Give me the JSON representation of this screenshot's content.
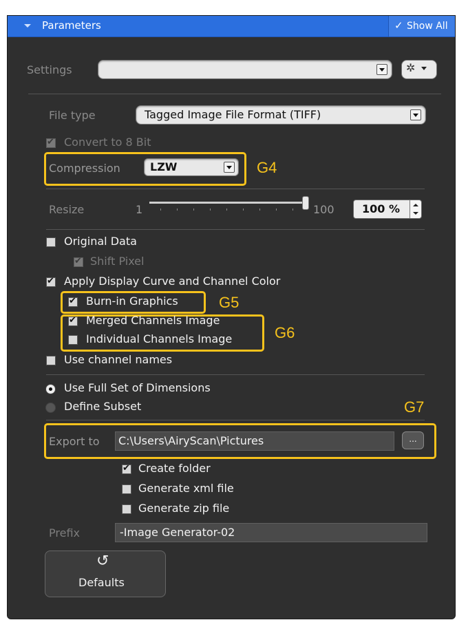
{
  "header": {
    "title": "Parameters",
    "show_all": "Show All",
    "check_glyph": "✓"
  },
  "settings": {
    "label": "Settings",
    "value": "",
    "gear_glyph": "✲"
  },
  "file_type": {
    "label": "File type",
    "value": "Tagged Image File Format (TIFF)"
  },
  "convert": {
    "label": "Convert to 8 Bit",
    "checked": true
  },
  "compression": {
    "label": "Compression",
    "value": "LZW"
  },
  "resize": {
    "label": "Resize",
    "min": "1",
    "max": "100",
    "value": "100 %",
    "level": 1.0
  },
  "options": {
    "original_data": "Original Data",
    "shift_pixel": "Shift Pixel",
    "apply_display": "Apply Display Curve and Channel Color",
    "burn_in": "Burn-in Graphics",
    "merged": "Merged Channels Image",
    "individual": "Individual Channels Image",
    "channel_names": "Use channel names"
  },
  "dimensions": {
    "full_set": "Use Full Set of Dimensions",
    "subset": "Define Subset"
  },
  "export": {
    "label": "Export to",
    "path": "C:\\Users\\AiryScan\\Pictures",
    "browse": "..."
  },
  "export_options": {
    "create_folder": "Create folder",
    "xml": "Generate xml file",
    "zip": "Generate zip file"
  },
  "prefix": {
    "label": "Prefix",
    "value": "-Image Generator-02"
  },
  "defaults": {
    "label": "Defaults",
    "icon_glyph": "↺"
  },
  "annotations": {
    "g4": "G4",
    "g5": "G5",
    "g6": "G6",
    "g7": "G7"
  },
  "colors": {
    "accent": "#2b6fdf",
    "panel": "#2f2f2f",
    "annotation": "#f6c21c"
  }
}
